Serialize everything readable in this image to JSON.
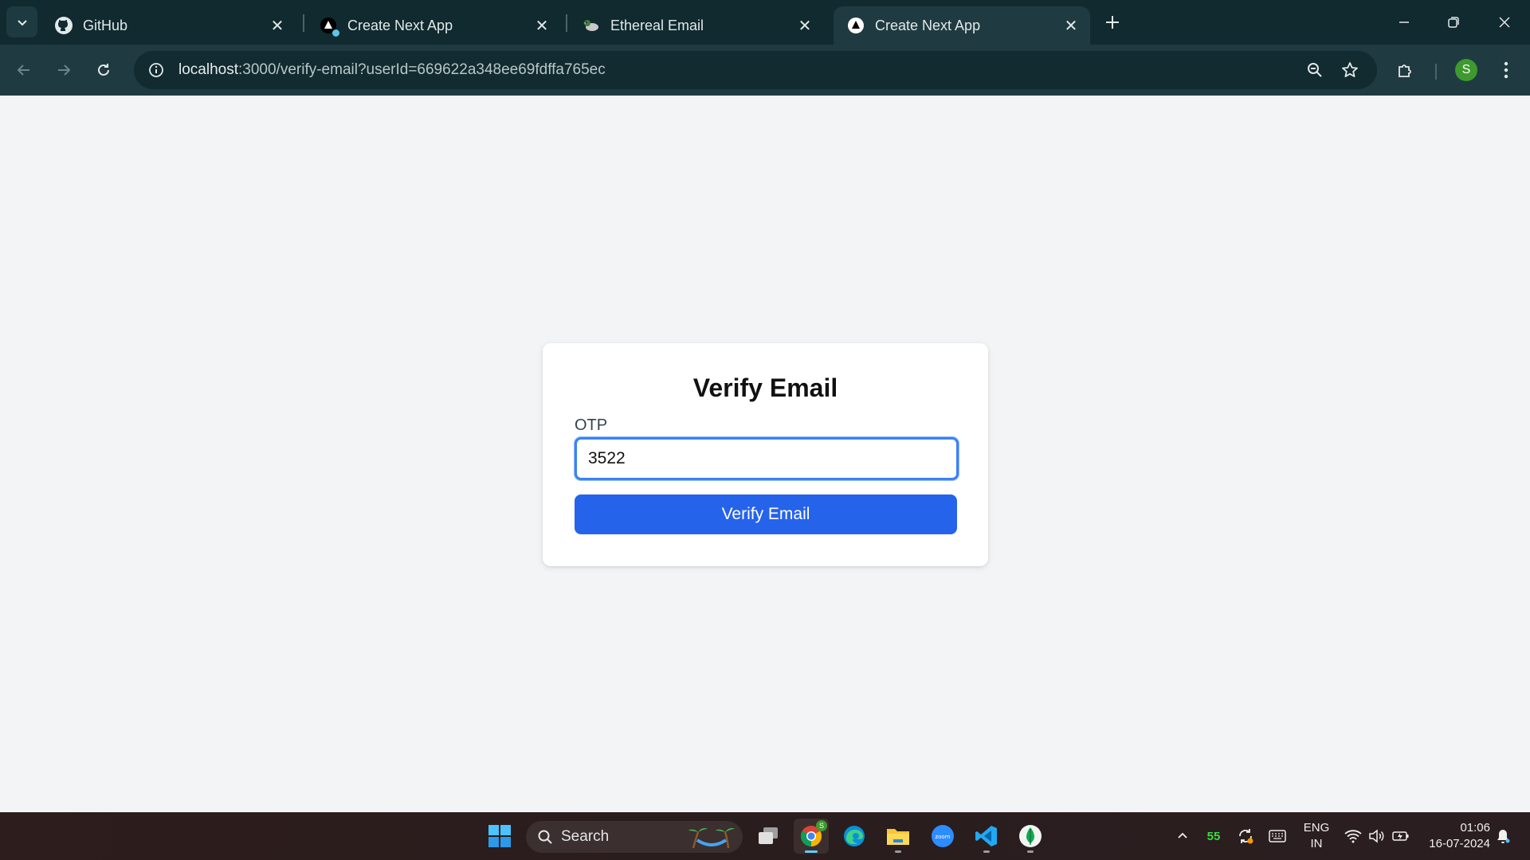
{
  "browser": {
    "tabs": [
      {
        "title": "GitHub",
        "icon": "github-icon",
        "active": false
      },
      {
        "title": "Create Next App",
        "icon": "nextjs-icon",
        "active": false
      },
      {
        "title": "Ethereal Email",
        "icon": "ethereal-duck-icon",
        "active": false
      },
      {
        "title": "Create Next App",
        "icon": "nextjs-icon",
        "active": true
      }
    ],
    "address_bar": {
      "host": "localhost",
      "path": ":3000/verify-email?userId=669622a348ee69fdffa765ec"
    },
    "profile_initial": "S"
  },
  "page": {
    "heading": "Verify Email",
    "otp_label": "OTP",
    "otp_value": "3522",
    "submit_label": "Verify Email"
  },
  "taskbar": {
    "search_label": "Search",
    "tray_badge": "55",
    "language": {
      "line1": "ENG",
      "line2": "IN"
    },
    "clock": {
      "time": "01:06",
      "date": "16-07-2024"
    }
  },
  "colors": {
    "tab_strip": "#102a2f",
    "toolbar": "#1f3b41",
    "page_bg": "#f3f4f6",
    "button": "#2563eb",
    "input_focus": "#3b82f6"
  }
}
